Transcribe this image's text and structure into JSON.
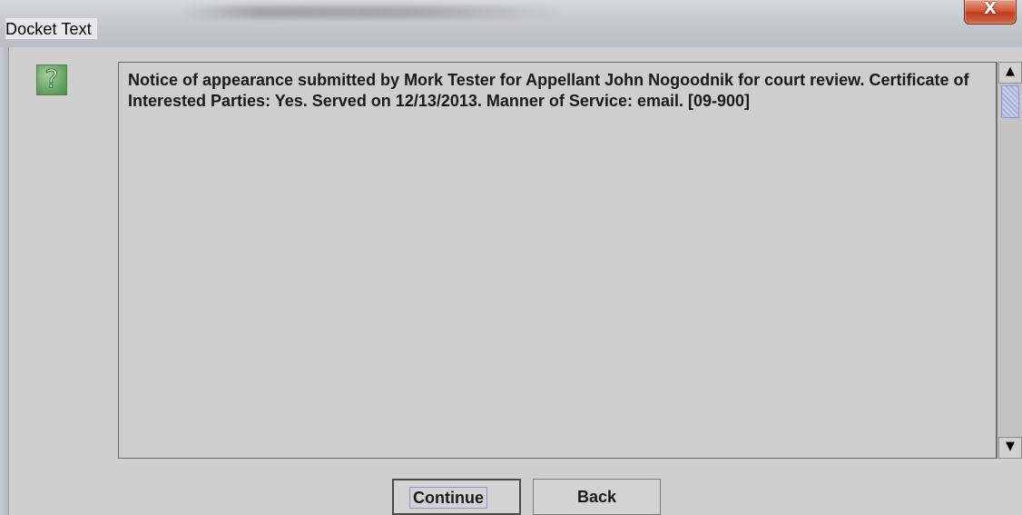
{
  "window": {
    "title": "Docket Text",
    "close_symbol": "X"
  },
  "icons": {
    "question": "question-mark-icon",
    "question_glyph": "?",
    "scroll_up_glyph": "▲",
    "scroll_down_glyph": "▼"
  },
  "content": {
    "docket_text": "Notice of appearance submitted by Mork Tester for Appellant John Nogoodnik for court review. Certificate of Interested Parties: Yes. Served on 12/13/2013. Manner of Service: email. [09-900]"
  },
  "buttons": {
    "continue_label": "Continue",
    "back_label": "Back"
  },
  "colors": {
    "close_button": "#c9472a",
    "icon_green": "#6ea86a",
    "scroll_thumb": "#a8b2dc"
  }
}
